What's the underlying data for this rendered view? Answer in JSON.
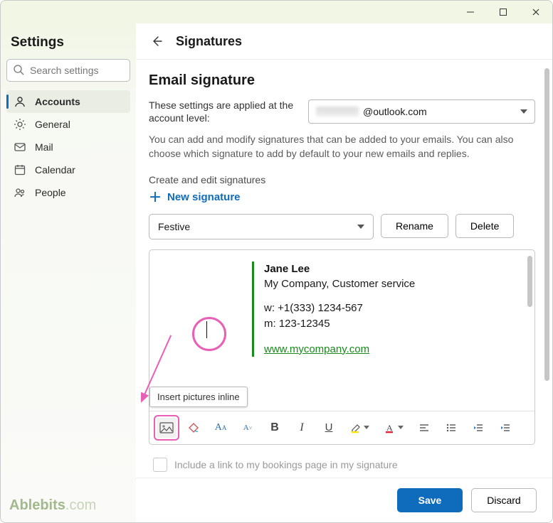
{
  "window": {
    "titlebar": {
      "minimize": "–",
      "maximize": "▢",
      "close": "✕"
    }
  },
  "sidebar": {
    "title": "Settings",
    "search_placeholder": "Search settings",
    "items": [
      {
        "label": "Accounts",
        "active": true
      },
      {
        "label": "General",
        "active": false
      },
      {
        "label": "Mail",
        "active": false
      },
      {
        "label": "Calendar",
        "active": false
      },
      {
        "label": "People",
        "active": false
      }
    ],
    "brand": "Ablebits",
    "brand_suffix": ".com"
  },
  "header": {
    "title": "Signatures"
  },
  "content": {
    "section_title": "Email signature",
    "account_caption": "These settings are applied at the account level:",
    "account_value": "@outlook.com",
    "description": "You can add and modify signatures that can be added to your emails. You can also choose which signature to add by default to your new emails and replies.",
    "create_edit_label": "Create and edit signatures",
    "new_signature_label": "New signature",
    "signature_select": "Festive",
    "rename_label": "Rename",
    "delete_label": "Delete",
    "tooltip": "Insert pictures inline",
    "include_booking_label": "Include a link to my bookings page in my signature"
  },
  "editor_signature": {
    "name": "Jane Lee",
    "company": "My Company, Customer service",
    "phone_w_prefix": "w:",
    "phone_w": "+1(333) 1234-567",
    "phone_m_prefix": "m:",
    "phone_m": "123-12345",
    "url": "www.mycompany.com"
  },
  "toolbar_icons": {
    "picture": "insert-picture-icon",
    "format_painter": "format-painter-icon",
    "font_size_up": "font-size-up-icon",
    "font_size_down": "font-size-down-icon",
    "bold": "B",
    "italic": "I",
    "underline": "U",
    "highlight": "highlight-icon",
    "font_color": "font-color-icon",
    "align": "align-icon",
    "list": "bullet-list-icon",
    "outdent": "outdent-icon",
    "indent": "indent-icon"
  },
  "footer": {
    "save": "Save",
    "discard": "Discard"
  }
}
